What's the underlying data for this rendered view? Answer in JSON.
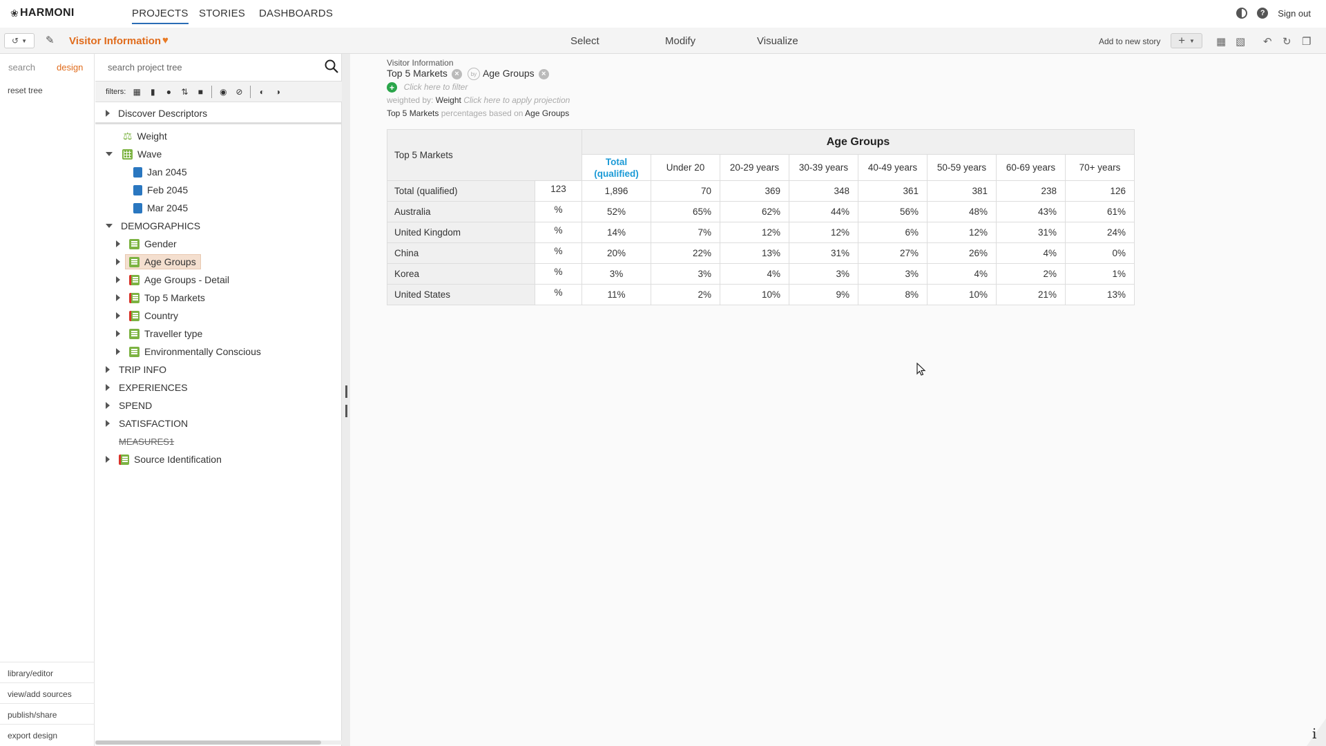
{
  "app": {
    "logo": "HARMONI",
    "nav": [
      "PROJECTS",
      "STORIES",
      "DASHBOARDS"
    ],
    "active_nav": "PROJECTS",
    "sign_out": "Sign out"
  },
  "toolbar": {
    "project_title": "Visitor Information",
    "modes": [
      "Select",
      "Modify",
      "Visualize"
    ],
    "add_to_story": "Add to new story",
    "accent_color": "#e06b1b"
  },
  "leftnav": {
    "tabs": [
      "search",
      "design"
    ],
    "active_tab": "design",
    "reset_tree": "reset tree",
    "bottom_links": [
      "library/editor",
      "view/add sources",
      "publish/share",
      "export design"
    ]
  },
  "tree": {
    "search_placeholder": "search project tree",
    "filters_label": "filters:",
    "discover": "Discover Descriptors",
    "weight": "Weight",
    "wave": "Wave",
    "wave_items": [
      "Jan 2045",
      "Feb 2045",
      "Mar 2045"
    ],
    "demographics": "DEMOGRAPHICS",
    "demo_items": [
      "Gender",
      "Age Groups",
      "Age Groups - Detail",
      "Top 5 Markets",
      "Country",
      "Traveller type",
      "Environmentally Conscious"
    ],
    "selected": "Age Groups",
    "folders": [
      "TRIP INFO",
      "EXPERIENCES",
      "SPEND",
      "SATISFACTION"
    ],
    "measures": "MEASURES1",
    "source_id": "Source Identification"
  },
  "table_header": {
    "source": "Visitor Information",
    "row_var": "Top 5 Markets",
    "col_var": "Age Groups",
    "filter_hint": "Click here to filter",
    "weighted_by_label": "weighted by:",
    "weight_var": "Weight",
    "projection_hint": "Click here to apply projection",
    "summary_row": "Top 5 Markets",
    "summary_mid": "percentages based on",
    "summary_col": "Age Groups"
  },
  "crosstab": {
    "corner": "Top 5 Markets",
    "banner": "Age Groups",
    "columns": [
      "Total (qualified)",
      "Under 20",
      "20-29 years",
      "30-39 years",
      "40-49 years",
      "50-59 years",
      "60-69 years",
      "70+ years"
    ],
    "rows": [
      {
        "label": "Total (qualified)",
        "unit": "123",
        "values": [
          "1,896",
          "70",
          "369",
          "348",
          "361",
          "381",
          "238",
          "126"
        ]
      },
      {
        "label": "Australia",
        "unit": "%",
        "values": [
          "52%",
          "65%",
          "62%",
          "44%",
          "56%",
          "48%",
          "43%",
          "61%"
        ]
      },
      {
        "label": "United Kingdom",
        "unit": "%",
        "values": [
          "14%",
          "7%",
          "12%",
          "12%",
          "6%",
          "12%",
          "31%",
          "24%"
        ]
      },
      {
        "label": "China",
        "unit": "%",
        "values": [
          "20%",
          "22%",
          "13%",
          "31%",
          "27%",
          "26%",
          "4%",
          "0%"
        ]
      },
      {
        "label": "Korea",
        "unit": "%",
        "values": [
          "3%",
          "3%",
          "4%",
          "3%",
          "3%",
          "4%",
          "2%",
          "1%"
        ]
      },
      {
        "label": "United States",
        "unit": "%",
        "values": [
          "11%",
          "2%",
          "10%",
          "9%",
          "8%",
          "10%",
          "21%",
          "13%"
        ]
      }
    ]
  }
}
